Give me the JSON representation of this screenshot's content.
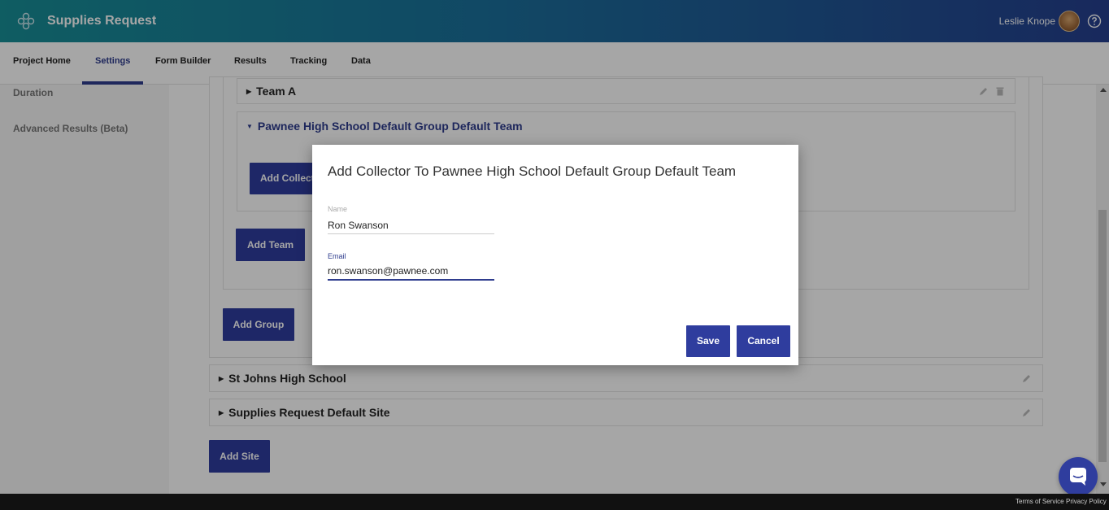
{
  "header": {
    "app_title": "Supplies Request",
    "user_name": "Leslie Knope",
    "brand_color": "#2f3d8e"
  },
  "tabs": [
    {
      "label": "Project Home"
    },
    {
      "label": "Settings",
      "active": true
    },
    {
      "label": "Form Builder"
    },
    {
      "label": "Results"
    },
    {
      "label": "Tracking"
    },
    {
      "label": "Data"
    }
  ],
  "sidebar": {
    "items": [
      {
        "label": "Duration"
      },
      {
        "label": "Advanced Results (Beta)"
      }
    ]
  },
  "main": {
    "team_a": "Team A",
    "default_team": "Pawnee High School Default Group Default Team",
    "add_collector_label": "Add Collector",
    "add_team_label": "Add Team",
    "add_group_label": "Add Group",
    "site_1": "St Johns High School",
    "site_2": "Supplies Request Default Site",
    "add_site_label": "Add Site"
  },
  "modal": {
    "title": "Add Collector To Pawnee High School Default Group Default Team",
    "name_label": "Name",
    "name_value": "Ron Swanson",
    "email_label": "Email",
    "email_value": "ron.swanson@pawnee.com",
    "save_label": "Save",
    "cancel_label": "Cancel"
  },
  "footer": {
    "terms": "Terms of Service",
    "privacy": "Privacy Policy"
  }
}
